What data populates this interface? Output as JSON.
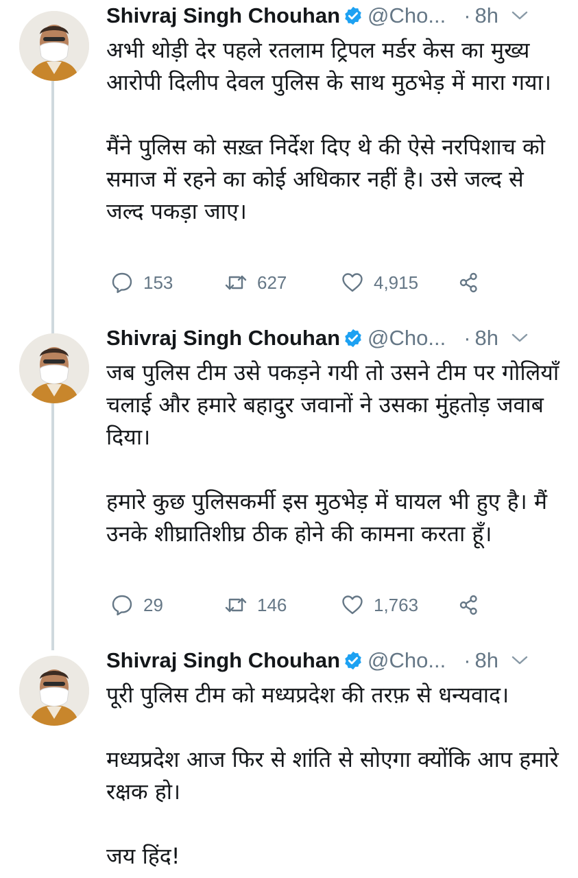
{
  "colors": {
    "text": "#14171a",
    "muted": "#657786",
    "verified": "#1da1f2",
    "thread": "#cfd9de"
  },
  "tweets": [
    {
      "name": "Shivraj Singh Chouhan",
      "handle": "@Cho...",
      "dot": "·",
      "time": "8h",
      "paragraphs": [
        "अभी थोड़ी देर पहले रतलाम ट्रिपल मर्डर केस का मुख्य आरोपी दिलीप देवल पुलिस के साथ मुठभेड़ में मारा गया।",
        "मैंने पुलिस को सख़्त निर्देश दिए थे की ऐसे नरपिशाच को समाज में रहने का कोई अधिकार नहीं है। उसे जल्द से जल्द पकड़ा जाए।"
      ],
      "replies": "153",
      "retweets": "627",
      "likes": "4,915"
    },
    {
      "name": "Shivraj Singh Chouhan",
      "handle": "@Cho...",
      "dot": "·",
      "time": "8h",
      "paragraphs": [
        "जब पुलिस टीम उसे पकड़ने गयी तो उसने टीम पर गोलियाँ चलाई और हमारे बहादुर जवानों ने उसका मुंहतोड़ जवाब दिया।",
        "हमारे कुछ पुलिसकर्मी इस मुठभेड़ में घायल भी हुए है। मैं उनके शीघ्रातिशीघ्र ठीक होने की कामना करता हूँ।"
      ],
      "replies": "29",
      "retweets": "146",
      "likes": "1,763"
    },
    {
      "name": "Shivraj Singh Chouhan",
      "handle": "@Cho...",
      "dot": "·",
      "time": "8h",
      "paragraphs": [
        "पूरी पुलिस टीम को मध्यप्रदेश की तरफ़ से धन्यवाद।",
        "मध्यप्रदेश आज फिर से शांति से सोएगा क्योंकि आप हमारे रक्षक हो।",
        "जय हिंद!"
      ]
    }
  ]
}
